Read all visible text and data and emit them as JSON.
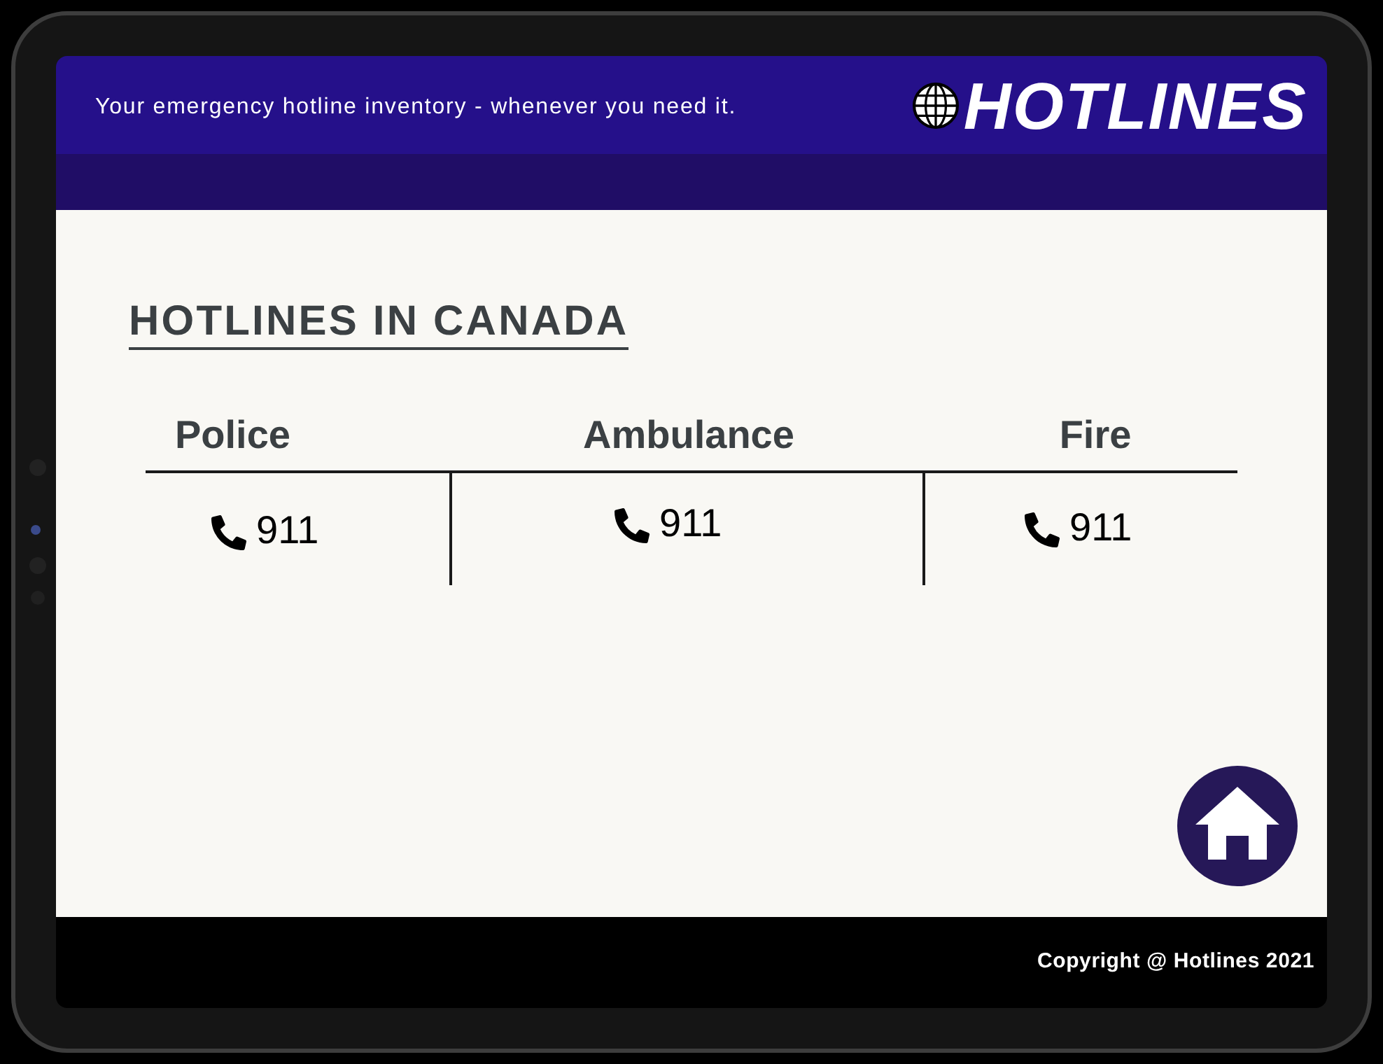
{
  "header": {
    "tagline": "Your emergency hotline inventory - whenever you need it.",
    "logo": "HOTLINES"
  },
  "page": {
    "heading": "HOTLINES IN CANADA"
  },
  "table": {
    "columns": [
      "Police",
      "Ambulance",
      "Fire"
    ],
    "rows": [
      [
        "911",
        "911",
        "911"
      ]
    ]
  },
  "footer": {
    "copyright": "Copyright @ Hotlines 2021"
  }
}
